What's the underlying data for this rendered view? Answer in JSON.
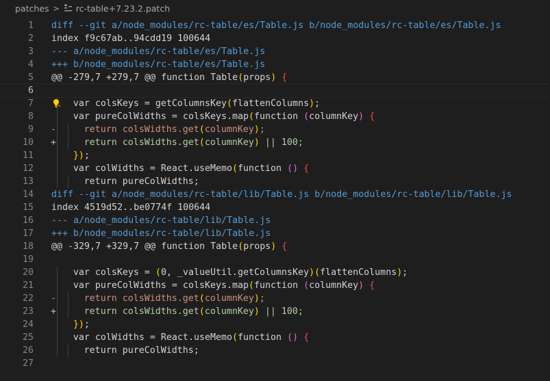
{
  "breadcrumb": {
    "folder": "patches",
    "separator": ">",
    "file": "rc-table+7.23.2.patch"
  },
  "lines": [
    {
      "n": "1",
      "kind": "diff",
      "text": "diff --git a/node_modules/rc-table/es/Table.js b/node_modules/rc-table/es/Table.js"
    },
    {
      "n": "2",
      "kind": "meta",
      "text": "index f9c67ab..94cdd19 100644"
    },
    {
      "n": "3",
      "kind": "delhdr",
      "text": "--- a/node_modules/rc-table/es/Table.js"
    },
    {
      "n": "4",
      "kind": "addhdr",
      "text": "+++ b/node_modules/rc-table/es/Table.js"
    },
    {
      "n": "5",
      "kind": "hunk",
      "text": "@@ -279,7 +279,7 @@ function Table(props) {"
    },
    {
      "n": "6",
      "kind": "blank",
      "text": ""
    },
    {
      "n": "7",
      "kind": "ctx",
      "text": "var colsKeys = getColumnsKey(flattenColumns);",
      "indent": 1,
      "lightbulb": true
    },
    {
      "n": "8",
      "kind": "ctx",
      "text": "var pureColWidths = colsKeys.map(function (columnKey) {",
      "indent": 1
    },
    {
      "n": "9",
      "kind": "del",
      "text": "return colsWidths.get(columnKey);",
      "indent": 2
    },
    {
      "n": "10",
      "kind": "add",
      "text": "return colsWidths.get(columnKey) || 100;",
      "indent": 2
    },
    {
      "n": "11",
      "kind": "ctx",
      "text": "});",
      "indent": 1
    },
    {
      "n": "12",
      "kind": "ctx",
      "text": "var colWidths = React.useMemo(function () {",
      "indent": 1
    },
    {
      "n": "13",
      "kind": "ctx",
      "text": "return pureColWidths;",
      "indent": 2
    },
    {
      "n": "14",
      "kind": "diff",
      "text": "diff --git a/node_modules/rc-table/lib/Table.js b/node_modules/rc-table/lib/Table.js"
    },
    {
      "n": "15",
      "kind": "meta",
      "text": "index 4519d52..be0774f 100644"
    },
    {
      "n": "16",
      "kind": "delhdr",
      "text": "--- a/node_modules/rc-table/lib/Table.js"
    },
    {
      "n": "17",
      "kind": "addhdr",
      "text": "+++ b/node_modules/rc-table/lib/Table.js"
    },
    {
      "n": "18",
      "kind": "hunk",
      "text": "@@ -329,7 +329,7 @@ function Table(props) {"
    },
    {
      "n": "19",
      "kind": "blank",
      "text": ""
    },
    {
      "n": "20",
      "kind": "ctx",
      "text": "var colsKeys = (0, _valueUtil.getColumnsKey)(flattenColumns);",
      "indent": 1
    },
    {
      "n": "21",
      "kind": "ctx",
      "text": "var pureColWidths = colsKeys.map(function (columnKey) {",
      "indent": 1
    },
    {
      "n": "22",
      "kind": "del",
      "text": "return colsWidths.get(columnKey);",
      "indent": 2
    },
    {
      "n": "23",
      "kind": "add",
      "text": "return colsWidths.get(columnKey) || 100;",
      "indent": 2
    },
    {
      "n": "24",
      "kind": "ctx",
      "text": "});",
      "indent": 1
    },
    {
      "n": "25",
      "kind": "ctx",
      "text": "var colWidths = React.useMemo(function () {",
      "indent": 1
    },
    {
      "n": "26",
      "kind": "ctx",
      "text": "return pureColWidths;",
      "indent": 2
    },
    {
      "n": "27",
      "kind": "blank",
      "text": ""
    }
  ],
  "current_line": "6",
  "markers": {
    "minus": "-",
    "plus": "+"
  },
  "icons": {
    "file": "diff-file-icon",
    "hint": "lightbulb-icon"
  },
  "colors": {
    "background": "#1e1e1e",
    "line_number": "#858585",
    "header": "#569cd6",
    "deleted": "#ce9178",
    "added": "#b5cea8",
    "bracket_1": "#ffd700",
    "bracket_2": "#da70d6",
    "bracket_3": "#179fff"
  }
}
